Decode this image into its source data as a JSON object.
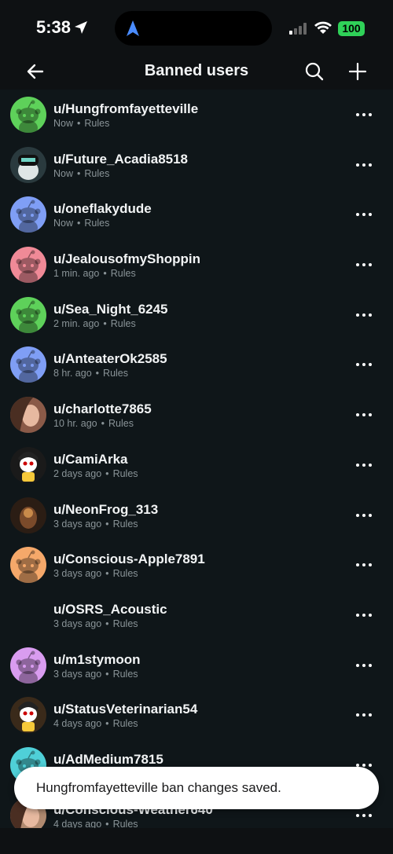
{
  "status_bar": {
    "time": "5:38",
    "battery": "100"
  },
  "header": {
    "title": "Banned users"
  },
  "users": [
    {
      "username": "u/Hungfromfayetteville",
      "time": "Now",
      "rules": "Rules",
      "avatar": "snoo",
      "color": "#5ed15a"
    },
    {
      "username": "u/Future_Acadia8518",
      "time": "Now",
      "rules": "Rules",
      "avatar": "custom-dark",
      "color": "#2a3a3e"
    },
    {
      "username": "u/oneflakydude",
      "time": "Now",
      "rules": "Rules",
      "avatar": "snoo",
      "color": "#7f9ef5"
    },
    {
      "username": "u/JealousofmyShoppin",
      "time": "1 min. ago",
      "rules": "Rules",
      "avatar": "snoo",
      "color": "#f08a97"
    },
    {
      "username": "u/Sea_Night_6245",
      "time": "2 min. ago",
      "rules": "Rules",
      "avatar": "snoo",
      "color": "#5ed15a"
    },
    {
      "username": "u/AnteaterOk2585",
      "time": "8 hr. ago",
      "rules": "Rules",
      "avatar": "snoo",
      "color": "#7f9ef5"
    },
    {
      "username": "u/charlotte7865",
      "time": "10 hr. ago",
      "rules": "Rules",
      "avatar": "photo",
      "color": "#8a5a48"
    },
    {
      "username": "u/CamiArka",
      "time": "2 days ago",
      "rules": "Rules",
      "avatar": "custom-yellow",
      "color": "#1a1a1a"
    },
    {
      "username": "u/NeonFrog_313",
      "time": "3 days ago",
      "rules": "Rules",
      "avatar": "photo-dark",
      "color": "#2b1d14"
    },
    {
      "username": "u/Conscious-Apple7891",
      "time": "3 days ago",
      "rules": "Rules",
      "avatar": "snoo",
      "color": "#f5a86a"
    },
    {
      "username": "u/OSRS_Acoustic",
      "time": "3 days ago",
      "rules": "Rules",
      "avatar": "none",
      "color": "#0f1619"
    },
    {
      "username": "u/m1stymoon",
      "time": "3 days ago",
      "rules": "Rules",
      "avatar": "snoo",
      "color": "#d99cf0"
    },
    {
      "username": "u/StatusVeterinarian54",
      "time": "4 days ago",
      "rules": "Rules",
      "avatar": "custom-yellow",
      "color": "#3a2a1a"
    },
    {
      "username": "u/AdMedium7815",
      "time": "",
      "rules": "",
      "avatar": "snoo",
      "color": "#4fd0d8"
    },
    {
      "username": "u/Conscious-Weather640",
      "time": "4 days ago",
      "rules": "Rules",
      "avatar": "photo",
      "color": "#b08a70"
    }
  ],
  "toast": {
    "message": "Hungfromfayetteville ban changes saved."
  },
  "colors": {
    "background": "#0e1113",
    "text": "#f2f4f5",
    "meta": "#8a9498",
    "battery": "#2fd158",
    "nav_accent": "#4a8cff"
  }
}
